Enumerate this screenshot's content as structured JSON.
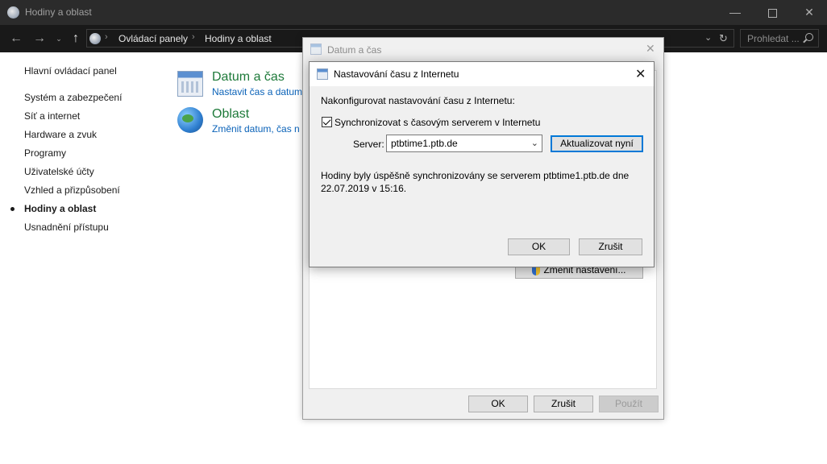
{
  "window": {
    "title": "Hodiny a oblast",
    "minimize": "—",
    "close": "✕"
  },
  "nav": {
    "back": "←",
    "forward": "→",
    "recent": "⌄",
    "up": "↑",
    "breadcrumb": [
      "Ovládací panely",
      "Hodiny a oblast"
    ],
    "breadcrumb_sep": "›",
    "dropdown": "⌄",
    "refresh": "↻",
    "search_placeholder": "Prohledat ..."
  },
  "sidebar": {
    "items": [
      {
        "label": "Hlavní ovládací panel",
        "active": false
      },
      {
        "label": "Systém a zabezpečení",
        "active": false
      },
      {
        "label": "Síť a internet",
        "active": false
      },
      {
        "label": "Hardware a zvuk",
        "active": false
      },
      {
        "label": "Programy",
        "active": false
      },
      {
        "label": "Uživatelské účty",
        "active": false
      },
      {
        "label": "Vzhled a přizpůsobení",
        "active": false
      },
      {
        "label": "Hodiny a oblast",
        "active": true
      },
      {
        "label": "Usnadnění přístupu",
        "active": false
      }
    ]
  },
  "main": {
    "categories": [
      {
        "title": "Datum a čas",
        "link": "Nastavit čas a datum",
        "icon": "calendar-clock-icon"
      },
      {
        "title": "Oblast",
        "link": "Změnit datum, čas n",
        "icon": "globe-icon"
      }
    ]
  },
  "datetime_dialog": {
    "title": "Datum a čas",
    "close": "✕",
    "change_settings_button": "Změnit nastavení...",
    "ok_button": "OK",
    "cancel_button": "Zrušit",
    "apply_button": "Použít"
  },
  "internet_time_dialog": {
    "title": "Nastavování času z Internetu",
    "close": "✕",
    "heading": "Nakonfigurovat nastavování času z Internetu:",
    "sync_checkbox_label": "Synchronizovat s časovým serverem v Internetu",
    "sync_checked": true,
    "server_label": "Server:",
    "server_value": "ptbtime1.ptb.de",
    "server_arrow": "⌄",
    "update_button": "Aktualizovat nyní",
    "status_line1": "Hodiny byly úspěšně synchronizovány se serverem ptbtime1.ptb.de dne",
    "status_line2": "22.07.2019 v 15:16.",
    "ok_button": "OK",
    "cancel_button": "Zrušit"
  },
  "colors": {
    "titlebar_bg": "#2b2b2b",
    "navbar_bg": "#191919",
    "category_title": "#1e7a3a",
    "category_link": "#0a62b8",
    "focus_border": "#0078d7"
  }
}
